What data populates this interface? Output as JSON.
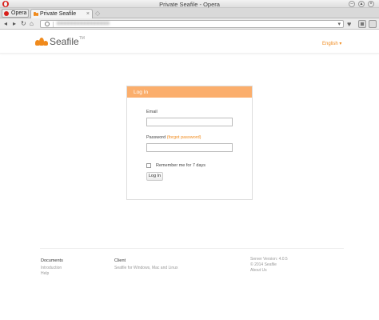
{
  "window": {
    "title": "Private Seafile - Opera"
  },
  "tabs": {
    "menu_label": "Opera",
    "active_tab": "Private Seafile",
    "close": "×",
    "new_tab": "◇"
  },
  "toolbar": {
    "back": "◂",
    "forward": "▸",
    "reload": "↻",
    "home": "⌂",
    "url": "■■■■■■■■■■■■■■■■",
    "dropdown": "▾",
    "heart": "♥"
  },
  "page": {
    "brand": "Seafile",
    "brand_tm": "TM",
    "language": "English ▾",
    "login": {
      "heading": "Log In",
      "email_label": "Email",
      "email_value": "",
      "password_label": "Password",
      "forgot_link": "(forgot password)",
      "password_value": "",
      "remember_label": "Remember me for 7 days",
      "submit_label": "Log In"
    },
    "footer": {
      "documents": {
        "heading": "Documents",
        "links": [
          "Introduction",
          "Help"
        ]
      },
      "client": {
        "heading": "Client",
        "links": [
          "Seafile for Windows, Mac and Linux"
        ]
      },
      "server": {
        "lines": [
          "Server Version: 4.0.5",
          "© 2014 Seafile",
          "About Us"
        ]
      }
    },
    "accent_color": "#f08a1c",
    "card_header_color": "#fbae6c"
  }
}
